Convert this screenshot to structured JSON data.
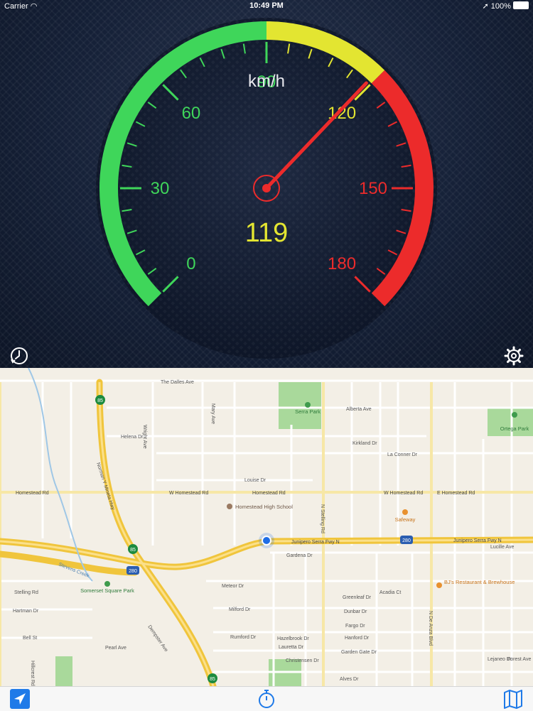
{
  "status_bar": {
    "carrier": "Carrier",
    "time": "10:49 PM",
    "battery": "100%"
  },
  "speedometer": {
    "unit": "km/h",
    "current_speed": "119",
    "speed_value": 119,
    "min": 0,
    "max": 180,
    "scale_labels": [
      "0",
      "30",
      "60",
      "90",
      "120",
      "150",
      "180"
    ],
    "zones": [
      {
        "from": 0,
        "to": 90,
        "color": "#3fd65a"
      },
      {
        "from": 90,
        "to": 120,
        "color": "#e3e531"
      },
      {
        "from": 120,
        "to": 180,
        "color": "#ec2b2b"
      }
    ],
    "needle_color": "#ec2b2b",
    "readout_color": "#e3e531"
  },
  "controls": {
    "history_icon": "clock-history-icon",
    "settings_icon": "gear-icon"
  },
  "map": {
    "street_labels": [
      "The Dalles Ave",
      "Alberta Ave",
      "Helena Dr",
      "Kirkland Dr",
      "La Conner Dr",
      "Louise Dr",
      "Homestead Rd",
      "W Homestead Rd",
      "E Homestead Rd",
      "Junipero Serra Fwy N",
      "Gardena Dr",
      "Meteor Dr",
      "Milford Dr",
      "Rumford Dr",
      "Hazelbrook Dr",
      "Lauretta Dr",
      "Greenleaf Dr",
      "Dunbar Dr",
      "Fargo Dr",
      "Hanford Dr",
      "Garden Gate Dr",
      "Acadia Ct",
      "Stelling Rd",
      "Hartman Dr",
      "Bell St",
      "Pearl Ave",
      "Lucille Ave",
      "Forest Ave",
      "Alves Dr",
      "Christensen Dr",
      "Norman Y Mineta Hwy",
      "N Stelling Rd",
      "N De Anza Blvd",
      "Stevens Creek",
      "Dempster Ave",
      "Wright Ave",
      "Mary Ave",
      "Helena Dr",
      "Lejaneo Dr",
      "Hillcrest Rd"
    ],
    "places": [
      {
        "name": "Serra Park"
      },
      {
        "name": "Ortega Park"
      },
      {
        "name": "Homestead High School"
      },
      {
        "name": "Safeway"
      },
      {
        "name": "BJ's Restaurant & Brewhouse"
      },
      {
        "name": "Somerset Square Park"
      }
    ],
    "shields": [
      "85",
      "85",
      "280",
      "280",
      "85"
    ]
  },
  "tab_bar": {
    "items": [
      "location-arrow-icon",
      "stopwatch-icon",
      "map-icon"
    ]
  }
}
